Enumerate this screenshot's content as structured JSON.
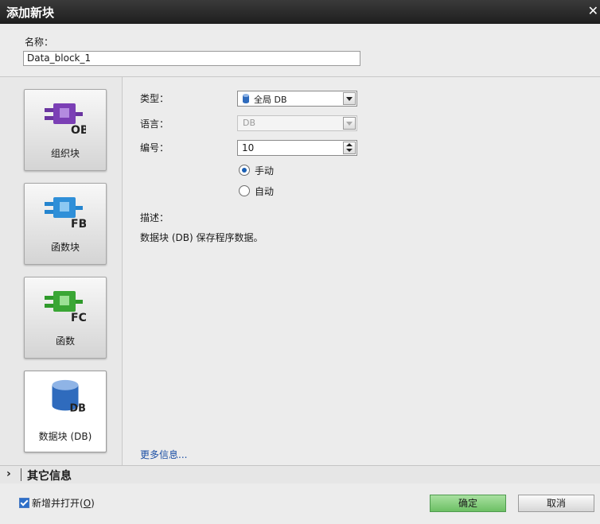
{
  "dialog": {
    "title": "添加新块",
    "close": "✕"
  },
  "name": {
    "label": "名称：",
    "value": "Data_block_1"
  },
  "blocks": [
    {
      "label": "组织块",
      "code": "OB",
      "color": "#7b3fb5"
    },
    {
      "label": "函数块",
      "code": "FB",
      "color": "#2f8fd8"
    },
    {
      "label": "函数",
      "code": "FC",
      "color": "#3aa635"
    },
    {
      "label": "数据块 (DB)",
      "code": "DB",
      "color": "#2f6bbd"
    }
  ],
  "form": {
    "type_label": "类型：",
    "type_value": "全局 DB",
    "language_label": "语言：",
    "language_value": "DB",
    "number_label": "编号：",
    "number_value": "10",
    "radio_manual": "手动",
    "radio_auto": "自动",
    "desc_label": "描述：",
    "desc_text": "数据块 (DB) 保存程序数据。",
    "more_info": "更多信息..."
  },
  "other_info": {
    "label": "其它信息"
  },
  "footer": {
    "add_open_label": "新增并打开",
    "add_open_shortcut": "O",
    "ok": "确定",
    "cancel": "取消"
  }
}
